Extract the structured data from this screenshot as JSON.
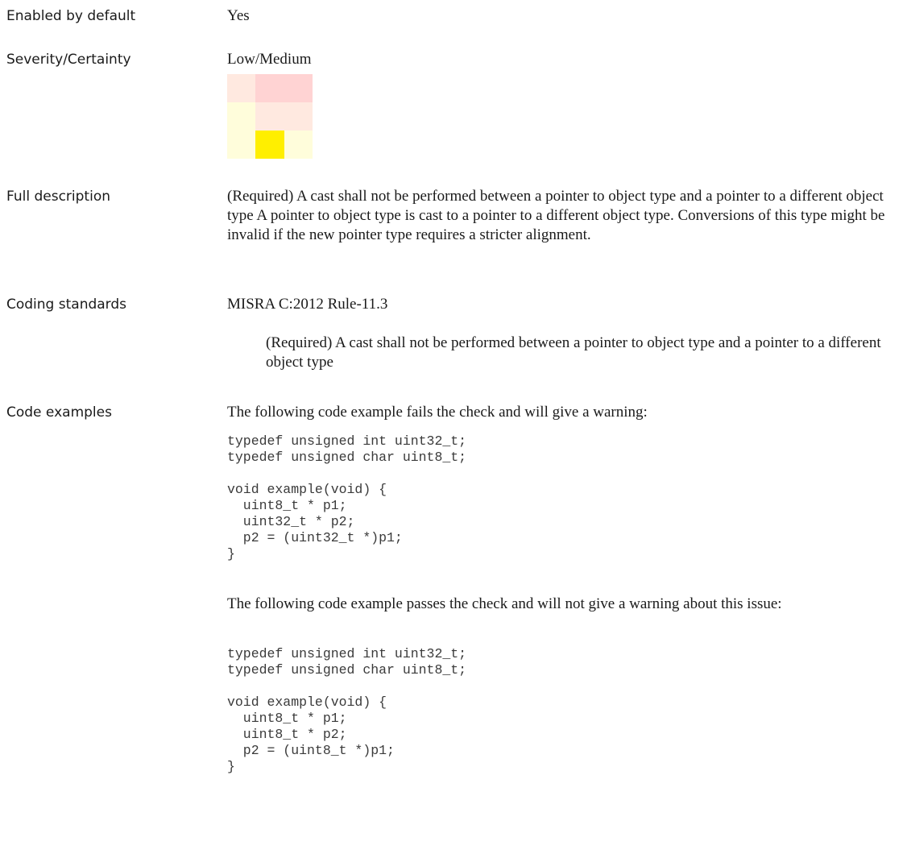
{
  "rows": {
    "enabled": {
      "label": "Enabled by default",
      "value": "Yes"
    },
    "severity": {
      "label": "Severity/Certainty",
      "value": "Low/Medium"
    },
    "full_description": {
      "label": "Full description",
      "text": "(Required) A cast shall not be performed between a pointer to object type and a pointer to a different object type A pointer to object type is cast to a pointer to a different object type. Conversions of this type might be invalid if the new pointer type requires a stricter alignment."
    },
    "coding_standards": {
      "label": "Coding standards",
      "standard": "MISRA C:2012 Rule-11.3",
      "rule_text": "(Required) A cast shall not be performed between a pointer to object type and a pointer to a different object type"
    },
    "code_examples": {
      "label": "Code examples",
      "fail_intro": "The following code example fails the check and will give a warning:",
      "fail_code": "typedef unsigned int uint32_t;\ntypedef unsigned char uint8_t;\n\nvoid example(void) {\n  uint8_t * p1;\n  uint32_t * p2;\n  p2 = (uint32_t *)p1;\n}",
      "pass_intro": "The following code example passes the check and will not give a warning about this issue:",
      "pass_code": "typedef unsigned int uint32_t;\ntypedef unsigned char uint8_t;\n\nvoid example(void) {\n  uint8_t * p1;\n  uint8_t * p2;\n  p2 = (uint8_t *)p1;\n}"
    }
  },
  "severity_matrix": {
    "cells": [
      [
        "#ffe9e0",
        "#ffd3d3",
        "#ffd3d3"
      ],
      [
        "#fffddb",
        "#ffe9e0",
        "#ffe9e0"
      ],
      [
        "#fffddb",
        "#ffef00",
        "#fffddb"
      ]
    ]
  }
}
